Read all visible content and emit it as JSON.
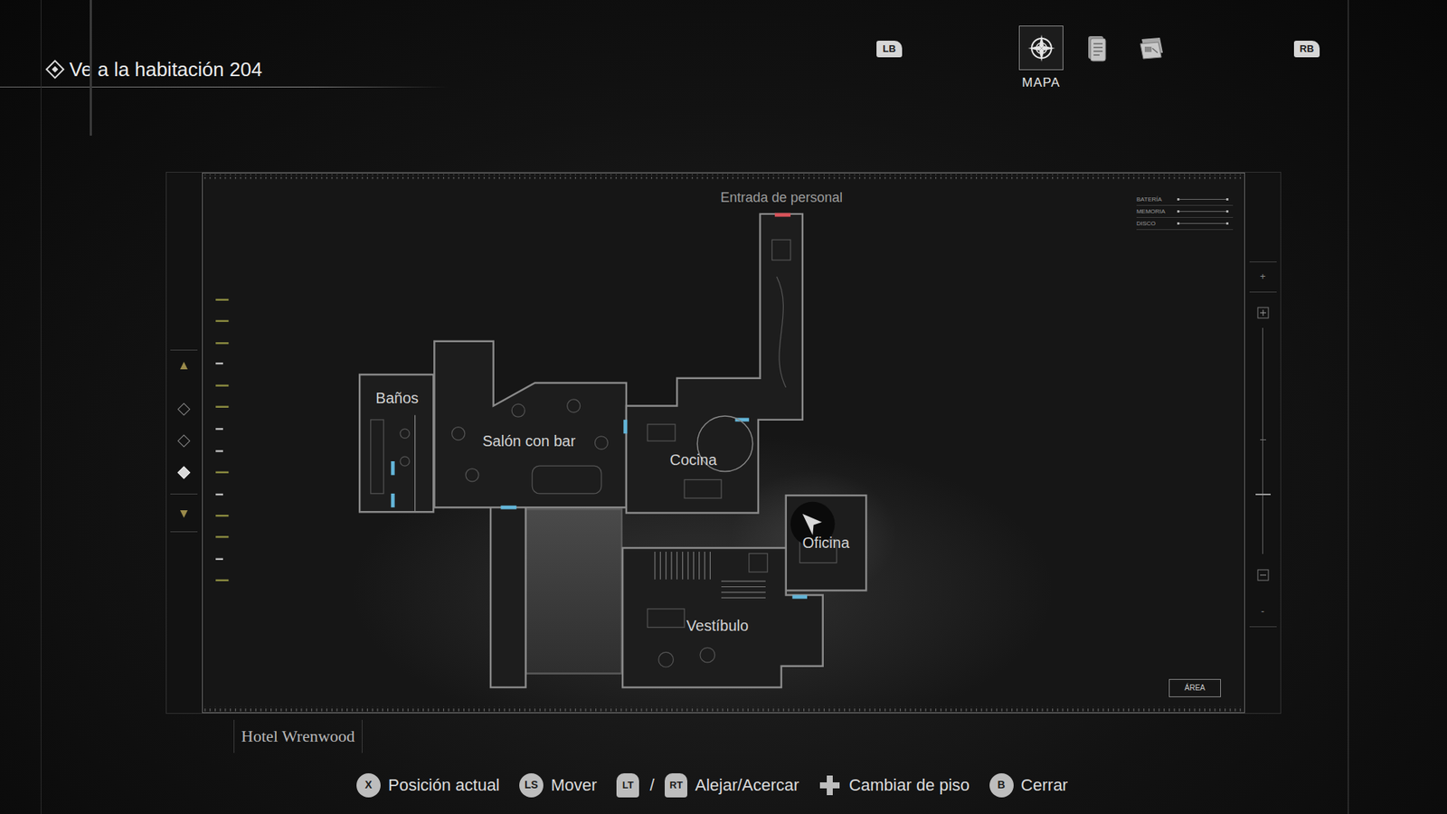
{
  "objective": {
    "text": "Ve a la habitación 204"
  },
  "tabs": [
    {
      "kind": "bumper",
      "label": "LB"
    },
    {
      "kind": "map",
      "label": "MAPA",
      "selected": true
    },
    {
      "kind": "manuscript",
      "selected": false
    },
    {
      "kind": "case-board",
      "selected": false
    },
    {
      "kind": "bumper",
      "label": "RB"
    }
  ],
  "map": {
    "rooms": [
      {
        "kind": "entrance",
        "label": "Entrada de personal"
      },
      {
        "kind": "room",
        "label": "Baños"
      },
      {
        "kind": "room",
        "label": "Salón con bar"
      },
      {
        "kind": "room",
        "label": "Cocina"
      },
      {
        "kind": "room",
        "label": "Oficina"
      },
      {
        "kind": "room",
        "label": "Vestíbulo"
      }
    ],
    "status": [
      {
        "label": "BATERÍA"
      },
      {
        "label": "MEMORIA"
      },
      {
        "label": "DISCO"
      }
    ],
    "area_button": "ÁREA",
    "floors": [
      {
        "selected": false
      },
      {
        "selected": false
      },
      {
        "selected": true
      }
    ],
    "zoom": {
      "in": "+",
      "out": "-",
      "level": 0.26
    }
  },
  "location": "Hotel Wrenwood",
  "hints": [
    {
      "keys": [
        {
          "kind": "round",
          "label": "X"
        }
      ],
      "label": "Posición actual"
    },
    {
      "keys": [
        {
          "kind": "round",
          "label": "LS"
        }
      ],
      "label": "Mover"
    },
    {
      "keys": [
        {
          "kind": "trigger",
          "label": "LT"
        },
        {
          "kind": "trigger",
          "label": "RT"
        }
      ],
      "separator": "/",
      "label": "Alejar/Acercar"
    },
    {
      "keys": [
        {
          "kind": "dpad"
        }
      ],
      "label": "Cambiar de piso"
    },
    {
      "keys": [
        {
          "kind": "round",
          "label": "B"
        }
      ],
      "label": "Cerrar"
    }
  ]
}
